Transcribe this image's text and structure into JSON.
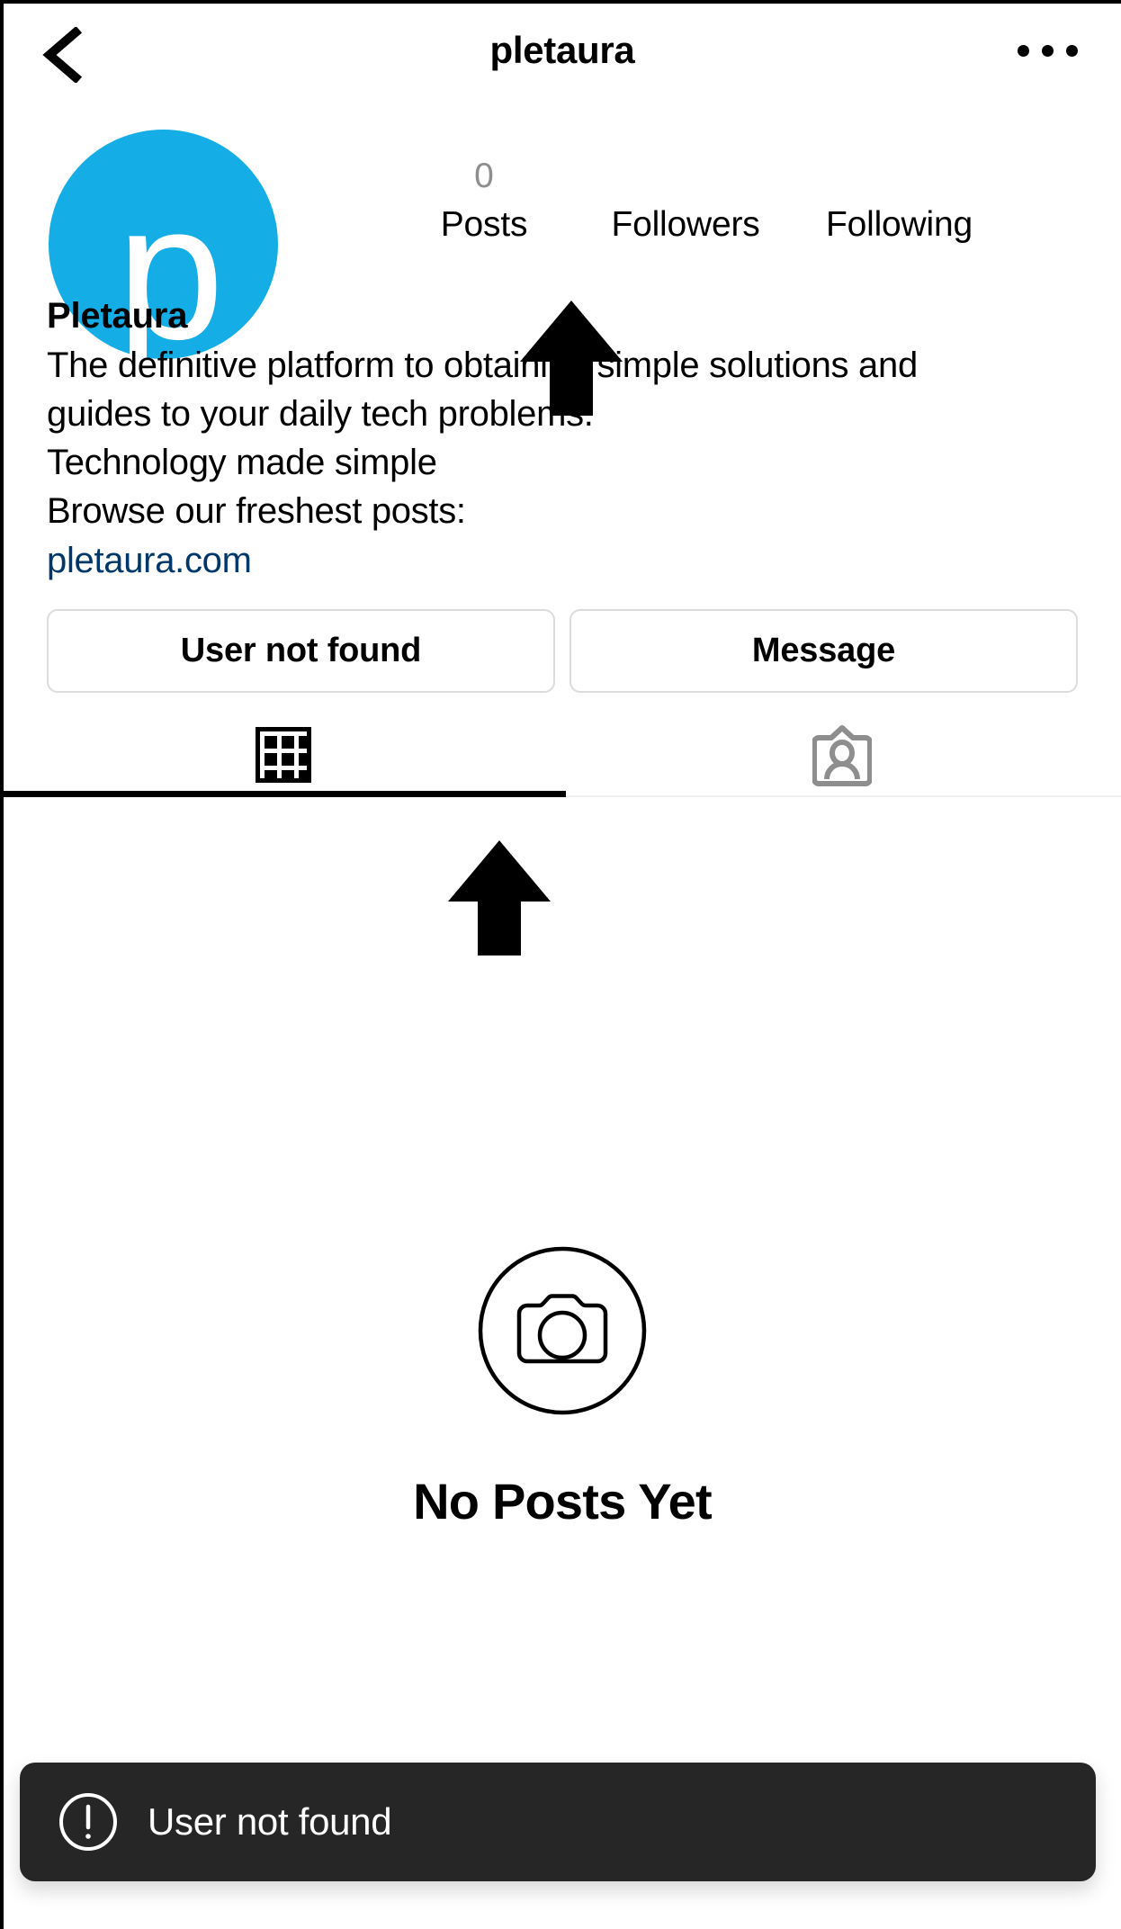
{
  "header": {
    "title": "pletaura",
    "back_icon": "back-chevron-icon",
    "menu_icon": "more-options-icon"
  },
  "profile": {
    "avatar_letter": "p",
    "avatar_color": "#14ADE5",
    "stats": [
      {
        "count": "0",
        "label": "Posts"
      },
      {
        "count": "",
        "label": "Followers"
      },
      {
        "count": "",
        "label": "Following"
      }
    ],
    "display_name": "Pletaura",
    "bio_lines": [
      "The definitive platform to obtaining simple solutions and",
      "guides to your daily tech problems.",
      "Technology made simple",
      "Browse our freshest posts:"
    ],
    "link": "pletaura.com",
    "link_color": "#00376B"
  },
  "actions": {
    "primary_label": "User not found",
    "secondary_label": "Message"
  },
  "tabs": [
    {
      "name": "grid",
      "icon": "grid-icon",
      "active": true
    },
    {
      "name": "tagged",
      "icon": "tagged-person-icon",
      "active": false
    }
  ],
  "empty_state": {
    "icon": "camera-circle-icon",
    "title": "No Posts Yet"
  },
  "toast": {
    "icon": "exclamation-circle-icon",
    "message": "User not found",
    "background": "#262626"
  },
  "annotations": [
    {
      "name": "arrow-pointing-to-followers",
      "icon": "up-arrow-icon"
    },
    {
      "name": "arrow-pointing-to-user-not-found-button",
      "icon": "up-arrow-icon"
    }
  ]
}
